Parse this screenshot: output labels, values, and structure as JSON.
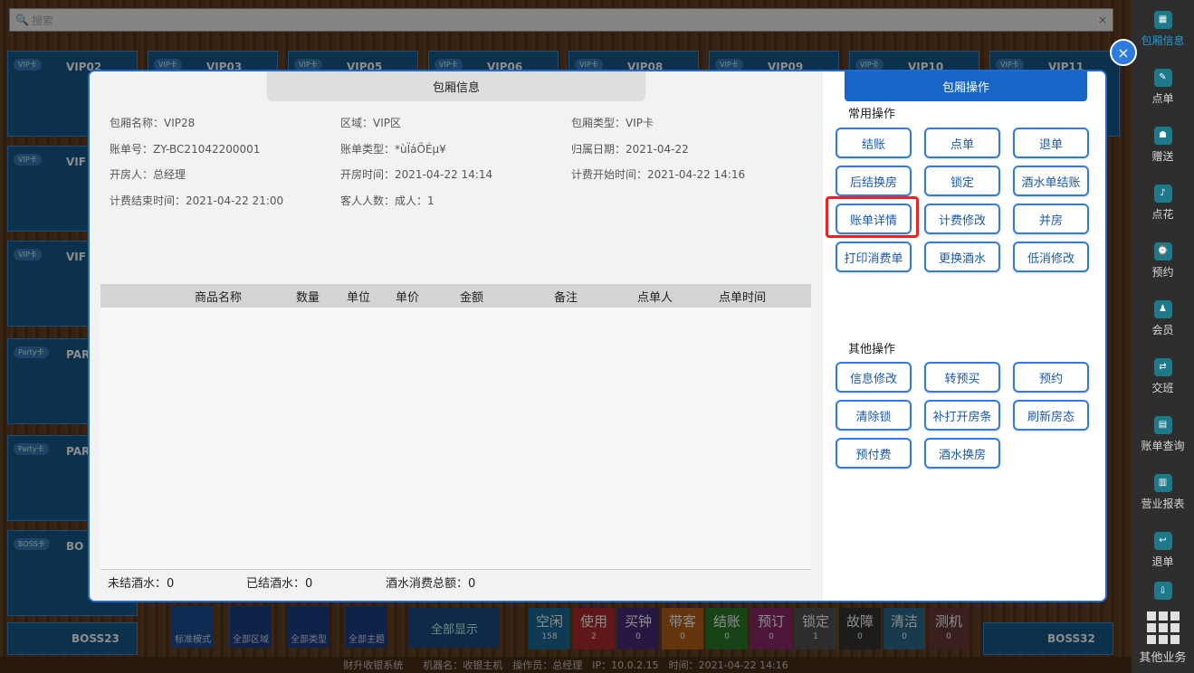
{
  "search": {
    "placeholder": "搜索",
    "clear": "×"
  },
  "tiles": [
    {
      "tag": "VIP卡",
      "name": "VIP02"
    },
    {
      "tag": "VIP卡",
      "name": "VIP03"
    },
    {
      "tag": "VIP卡",
      "name": "VIP05"
    },
    {
      "tag": "VIP卡",
      "name": "VIP06"
    },
    {
      "tag": "VIP卡",
      "name": "VIP08"
    },
    {
      "tag": "VIP卡",
      "name": "VIP09"
    },
    {
      "tag": "VIP卡",
      "name": "VIP10"
    },
    {
      "tag": "VIP卡",
      "name": "VIP11"
    },
    {
      "tag": "VIP卡",
      "name": "VIF"
    },
    {
      "tag": "VIP卡",
      "name": "VIF"
    },
    {
      "tag": "Party卡",
      "name": "PAR"
    },
    {
      "tag": "Party卡",
      "name": "PAR"
    },
    {
      "tag": "BOSS卡",
      "name": "BO"
    }
  ],
  "sidebar": [
    {
      "icon": "▦",
      "label": "包厢信息"
    },
    {
      "icon": "✎",
      "label": "点单"
    },
    {
      "icon": "☗",
      "label": "赠送"
    },
    {
      "icon": "♪",
      "label": "点花"
    },
    {
      "icon": "⌚",
      "label": "预约"
    },
    {
      "icon": "♟",
      "label": "会员"
    },
    {
      "icon": "⇄",
      "label": "交班"
    },
    {
      "icon": "▤",
      "label": "账单查询"
    },
    {
      "icon": "▥",
      "label": "营业报表"
    },
    {
      "icon": "↩",
      "label": "退单"
    },
    {
      "icon": "⇩",
      "label": ""
    }
  ],
  "sidebar_more": "其他业务",
  "modal": {
    "close": "×",
    "left_title": "包厢信息",
    "info": {
      "room_name": "包厢名称：VIP28",
      "area": "区域：VIP区",
      "room_type": "包厢类型：VIP卡",
      "bill_no": "账单号：ZY-BC21042200001",
      "bill_type": "账单类型：*ùÏáÕÉµ¥",
      "belong_date": "归属日期：2021-04-22",
      "opener": "开房人：总经理",
      "open_time": "开房时间：2021-04-22 14:14",
      "charge_start": "计费开始时间：2021-04-22 14:16",
      "charge_end": "计费结束时间：2021-04-22 21:00",
      "guests": "客人人数：成人：1"
    },
    "table_headers": [
      "商品名称",
      "数量",
      "单位",
      "单价",
      "金额",
      "备注",
      "点单人",
      "点单时间"
    ],
    "footer": {
      "unsettled": "未结酒水：0",
      "settled": "已结酒水：0",
      "total": "酒水消费总额：0"
    },
    "right_title": "包厢操作",
    "common_title": "常用操作",
    "common_ops": [
      "结账",
      "点单",
      "退单",
      "后结换房",
      "锁定",
      "酒水单结账",
      "账单详情",
      "计费修改",
      "并房",
      "打印消费单",
      "更换酒水",
      "低消修改"
    ],
    "other_title": "其他操作",
    "other_ops": [
      "信息修改",
      "转预买",
      "预约",
      "清除锁",
      "补打开房条",
      "刷新房态",
      "预付费",
      "酒水换房"
    ]
  },
  "bottom": {
    "mode_std": "标准模式",
    "all_area": "全部区域",
    "all_type": "全部类型",
    "all_theme": "全部主题",
    "all_show": "全部显示",
    "statuses": [
      {
        "label": "空闲",
        "count": "158",
        "color": "#1a6a9a"
      },
      {
        "label": "使用",
        "count": "2",
        "color": "#b02a2a"
      },
      {
        "label": "买钟",
        "count": "0",
        "color": "#4a2a7a"
      },
      {
        "label": "带客",
        "count": "0",
        "color": "#b8621a"
      },
      {
        "label": "结账",
        "count": "0",
        "color": "#2a7a2a"
      },
      {
        "label": "预订",
        "count": "0",
        "color": "#8a2a6a"
      },
      {
        "label": "锁定",
        "count": "1",
        "color": "#555555"
      },
      {
        "label": "故障",
        "count": "0",
        "color": "#333333"
      },
      {
        "label": "清洁",
        "count": "0",
        "color": "#2a6a8a"
      },
      {
        "label": "测机",
        "count": "0",
        "color": "#6a3a3a"
      }
    ],
    "boss_left": "BOSS23",
    "boss_right": "BOSS32",
    "boss_tag": "BOSS卡",
    "status_bar": "财升收银系统　　机器名：收银主机　操作员：总经理　IP：10.0.2.15　时间：2021-04-22 14:16"
  }
}
